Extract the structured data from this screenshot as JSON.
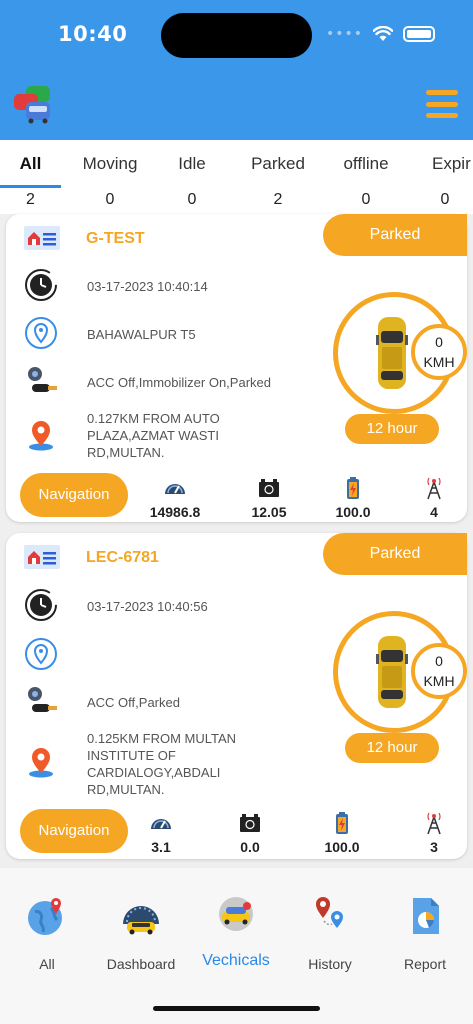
{
  "status_bar": {
    "time": "10:40"
  },
  "tabs": [
    {
      "label": "All",
      "count": "2"
    },
    {
      "label": "Moving",
      "count": "0"
    },
    {
      "label": "Idle",
      "count": "0"
    },
    {
      "label": "Parked",
      "count": "2"
    },
    {
      "label": "offline",
      "count": "0"
    },
    {
      "label": "Expir",
      "count": "0"
    }
  ],
  "vehicles": [
    {
      "name": "G-TEST",
      "status": "Parked",
      "datetime": "03-17-2023 10:40:14",
      "location": "BAHAWALPUR T5",
      "ignition": "ACC Off,Immobilizer On,Parked",
      "address": "0.127KM FROM AUTO PLAZA,AZMAT WASTI RD,MULTAN.",
      "speed": "0",
      "speed_unit": "KMH",
      "duration": "12 hour",
      "nav_label": "Navigation",
      "odometer": "14986.8",
      "voltage": "12.05",
      "battery": "100.0",
      "signal": "4"
    },
    {
      "name": "LEC-6781",
      "status": "Parked",
      "datetime": "03-17-2023 10:40:56",
      "location": "",
      "ignition": "ACC Off,Parked",
      "address": "0.125KM FROM MULTAN INSTITUTE OF CARDIALOGY,ABDALI RD,MULTAN.",
      "speed": "0",
      "speed_unit": "KMH",
      "duration": "12 hour",
      "nav_label": "Navigation",
      "odometer": "3.1",
      "voltage": "0.0",
      "battery": "100.0",
      "signal": "3"
    }
  ],
  "bottom_nav": [
    {
      "label": "All",
      "icon": "globe-pin-icon"
    },
    {
      "label": "Dashboard",
      "icon": "speedometer-car-icon"
    },
    {
      "label": "Vechicals",
      "icon": "car-pin-icon"
    },
    {
      "label": "History",
      "icon": "route-pins-icon"
    },
    {
      "label": "Report",
      "icon": "report-document-icon"
    }
  ],
  "colors": {
    "header": "#3a97ea",
    "accent": "#f5a623",
    "active": "#2b8ae8"
  }
}
